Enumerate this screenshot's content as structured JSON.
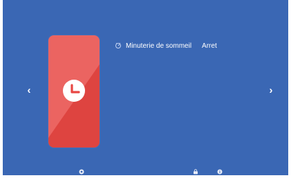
{
  "navigation": {
    "prev_glyph": "‹",
    "next_glyph": "›"
  },
  "card": {
    "icon": "clock-icon",
    "color": "#e84743"
  },
  "setting": {
    "icon": "sleep-timer-icon",
    "label": "Minuterie de sommeil",
    "value": "Arret"
  },
  "bottom_bar": {
    "icons": [
      "settings-icon",
      "lock-icon",
      "info-icon"
    ]
  },
  "colors": {
    "background": "#3a67b4",
    "card": "#e84743",
    "text": "#ffffff"
  }
}
